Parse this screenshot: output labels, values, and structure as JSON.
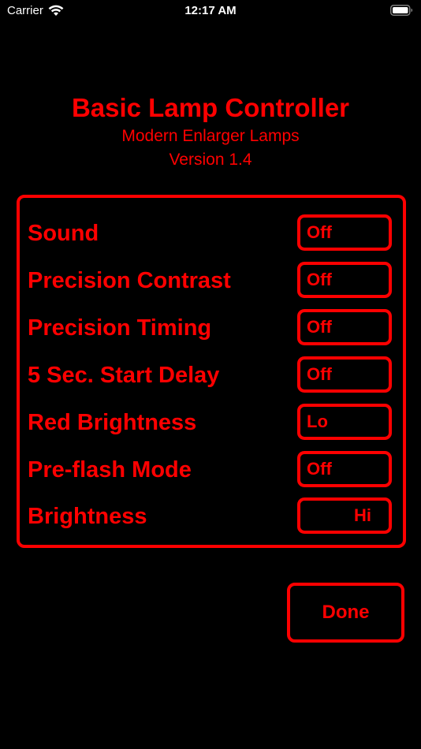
{
  "status_bar": {
    "carrier": "Carrier",
    "time": "12:17 AM",
    "wifi_icon": "wifi-icon",
    "battery_icon": "battery-icon",
    "text_color": "#ffffff"
  },
  "header": {
    "title": "Basic Lamp Controller",
    "subtitle": "Modern Enlarger Lamps",
    "version": "Version 1.4"
  },
  "settings": [
    {
      "label": "Sound",
      "value": "Off"
    },
    {
      "label": "Precision Contrast",
      "value": "Off"
    },
    {
      "label": "Precision Timing",
      "value": "Off"
    },
    {
      "label": "5 Sec. Start Delay",
      "value": "Off"
    },
    {
      "label": "Red Brightness",
      "value": "Lo"
    },
    {
      "label": "Pre-flash Mode",
      "value": "Off"
    },
    {
      "label": "Brightness",
      "value": "Hi"
    }
  ],
  "done_label": "Done",
  "colors": {
    "accent": "#ff0000",
    "background": "#000000"
  }
}
